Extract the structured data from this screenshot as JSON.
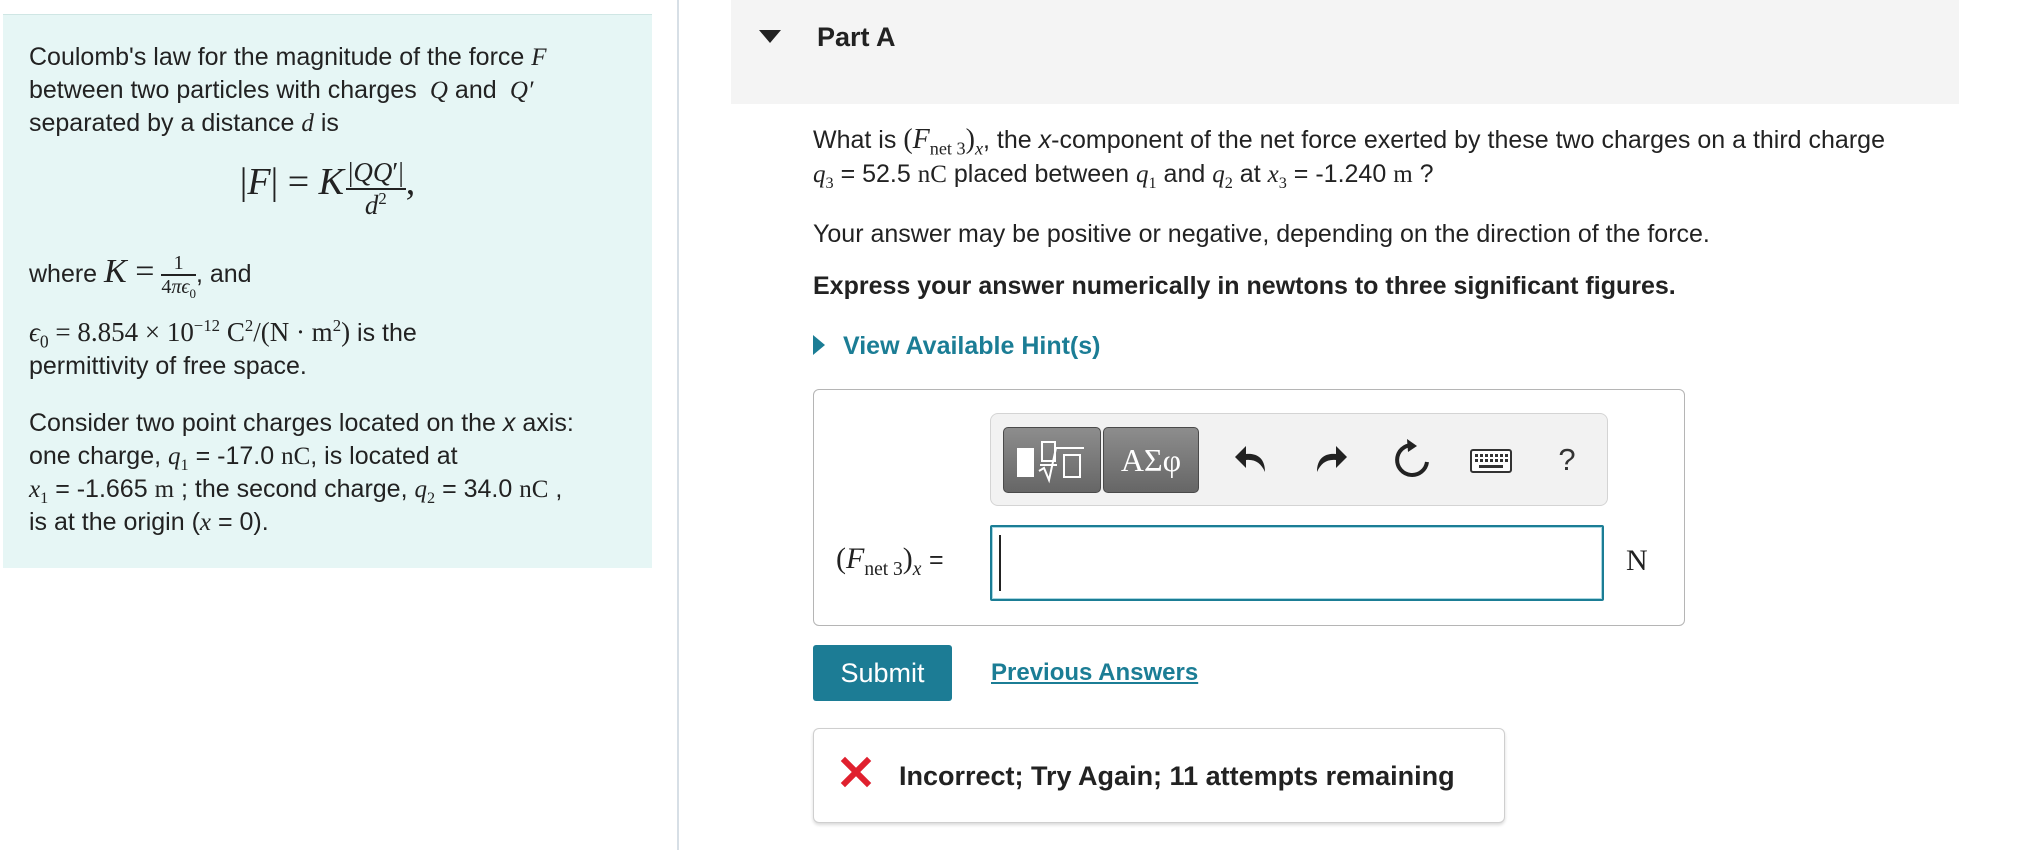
{
  "info_panel": {
    "intro_line1": "Coulomb's law for the magnitude of the force",
    "intro_line2_a": "between two particles with charges",
    "intro_line2_b": "and",
    "intro_line3": "separated by a distance",
    "intro_line3_end": "is",
    "where": "where",
    "and": ", and",
    "is_the": "is the",
    "permittivity": "permittivity of free space.",
    "consider_line1": "Consider two point charges located on the",
    "consider_axis": "x",
    "consider_axis_end": "axis:",
    "consider_line2_a": "one charge,",
    "q1_value": "= -17.0",
    "consider_line2_b": ", is located at",
    "x1_value": "= -1.665",
    "consider_line3_b": "; the second charge,",
    "q2_value": "= 34.0",
    "is_at_origin": "is at the origin (",
    "origin_value": "= 0)."
  },
  "part": {
    "title": "Part A"
  },
  "question": {
    "what_is": "What is",
    "line1_rest": ", the",
    "x_italic": "x",
    "line1_end": "-component of the net force exerted by these two charges on a third charge",
    "q3_value": "= 52.5",
    "placed_between": "placed between",
    "and": "and",
    "at": "at",
    "x3_value": "= -1.240",
    "question_mark": "?",
    "sign_note": "Your answer may be positive or negative, depending on the direction of the force.",
    "instruction": "Express your answer numerically in newtons to three significant figures."
  },
  "hint": {
    "label": "View Available Hint(s)"
  },
  "toolbar": {
    "greek_label": "ΑΣφ",
    "help_label": "?"
  },
  "answer": {
    "label_equals": "=",
    "value": "",
    "unit": "N"
  },
  "buttons": {
    "submit": "Submit",
    "previous_answers": "Previous Answers"
  },
  "feedback": {
    "message": "Incorrect; Try Again; 11 attempts remaining"
  },
  "colors": {
    "accent": "#1b7d95",
    "panel_bg": "#e6f6f5",
    "error": "#e0202e"
  }
}
